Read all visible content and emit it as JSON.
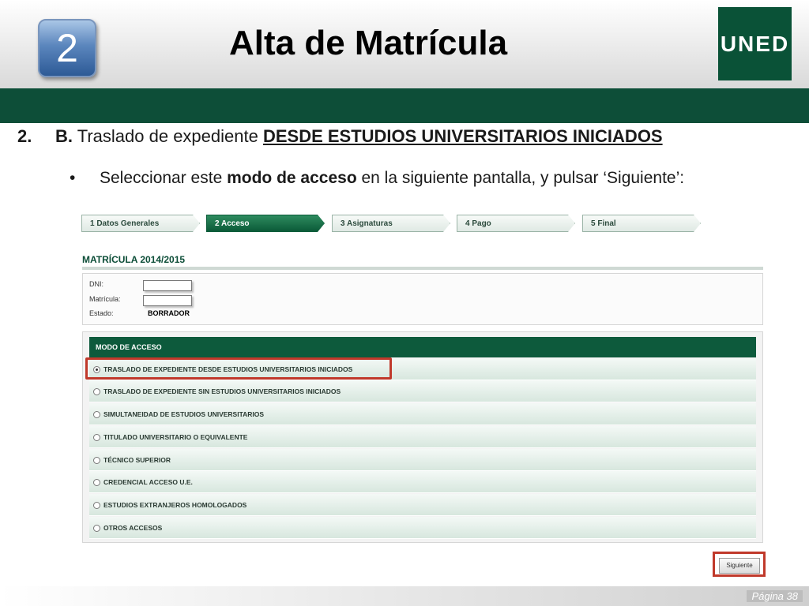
{
  "slide": {
    "badge_number": "2",
    "title": "Alta de Matrícula",
    "logo_text": "UNED",
    "line1_num": "2.",
    "line1_b": "B.",
    "line1_mid": " Traslado de expediente ",
    "line1_ul": "DESDE ESTUDIOS UNIVERSITARIOS INICIADOS",
    "bullet": "•",
    "line2_pre": "Seleccionar este ",
    "line2_bold": "modo de acceso",
    "line2_post": " en la siguiente pantalla, y pulsar ‘Siguiente’:",
    "page_label": "Página 38"
  },
  "wizard": {
    "steps": [
      {
        "label": "1  Datos Generales"
      },
      {
        "label": "2  Acceso"
      },
      {
        "label": "3  Asignaturas"
      },
      {
        "label": "4  Pago"
      },
      {
        "label": "5  Final"
      }
    ]
  },
  "form": {
    "section_title": "MATRÍCULA 2014/2015",
    "dni_label": "DNI:",
    "matricula_label": "Matrícula:",
    "estado_label": "Estado:",
    "estado_value": "BORRADOR",
    "access_header": "MODO DE ACCESO",
    "options": [
      {
        "label": "TRASLADO DE EXPEDIENTE DESDE ESTUDIOS UNIVERSITARIOS INICIADOS",
        "selected": true
      },
      {
        "label": "TRASLADO DE EXPEDIENTE SIN ESTUDIOS UNIVERSITARIOS INICIADOS",
        "selected": false
      },
      {
        "label": "SIMULTANEIDAD DE ESTUDIOS UNIVERSITARIOS",
        "selected": false
      },
      {
        "label": "TITULADO UNIVERSITARIO O EQUIVALENTE",
        "selected": false
      },
      {
        "label": "TÉCNICO SUPERIOR",
        "selected": false
      },
      {
        "label": "CREDENCIAL ACCESO U.E.",
        "selected": false
      },
      {
        "label": "ESTUDIOS EXTRANJEROS HOMOLOGADOS",
        "selected": false
      },
      {
        "label": "OTROS ACCESOS",
        "selected": false
      }
    ],
    "next_button": "Siguiente"
  },
  "colors": {
    "brand_green": "#0d4e38",
    "highlight_red": "#c0392b",
    "badge_blue": "#2d5a96"
  }
}
